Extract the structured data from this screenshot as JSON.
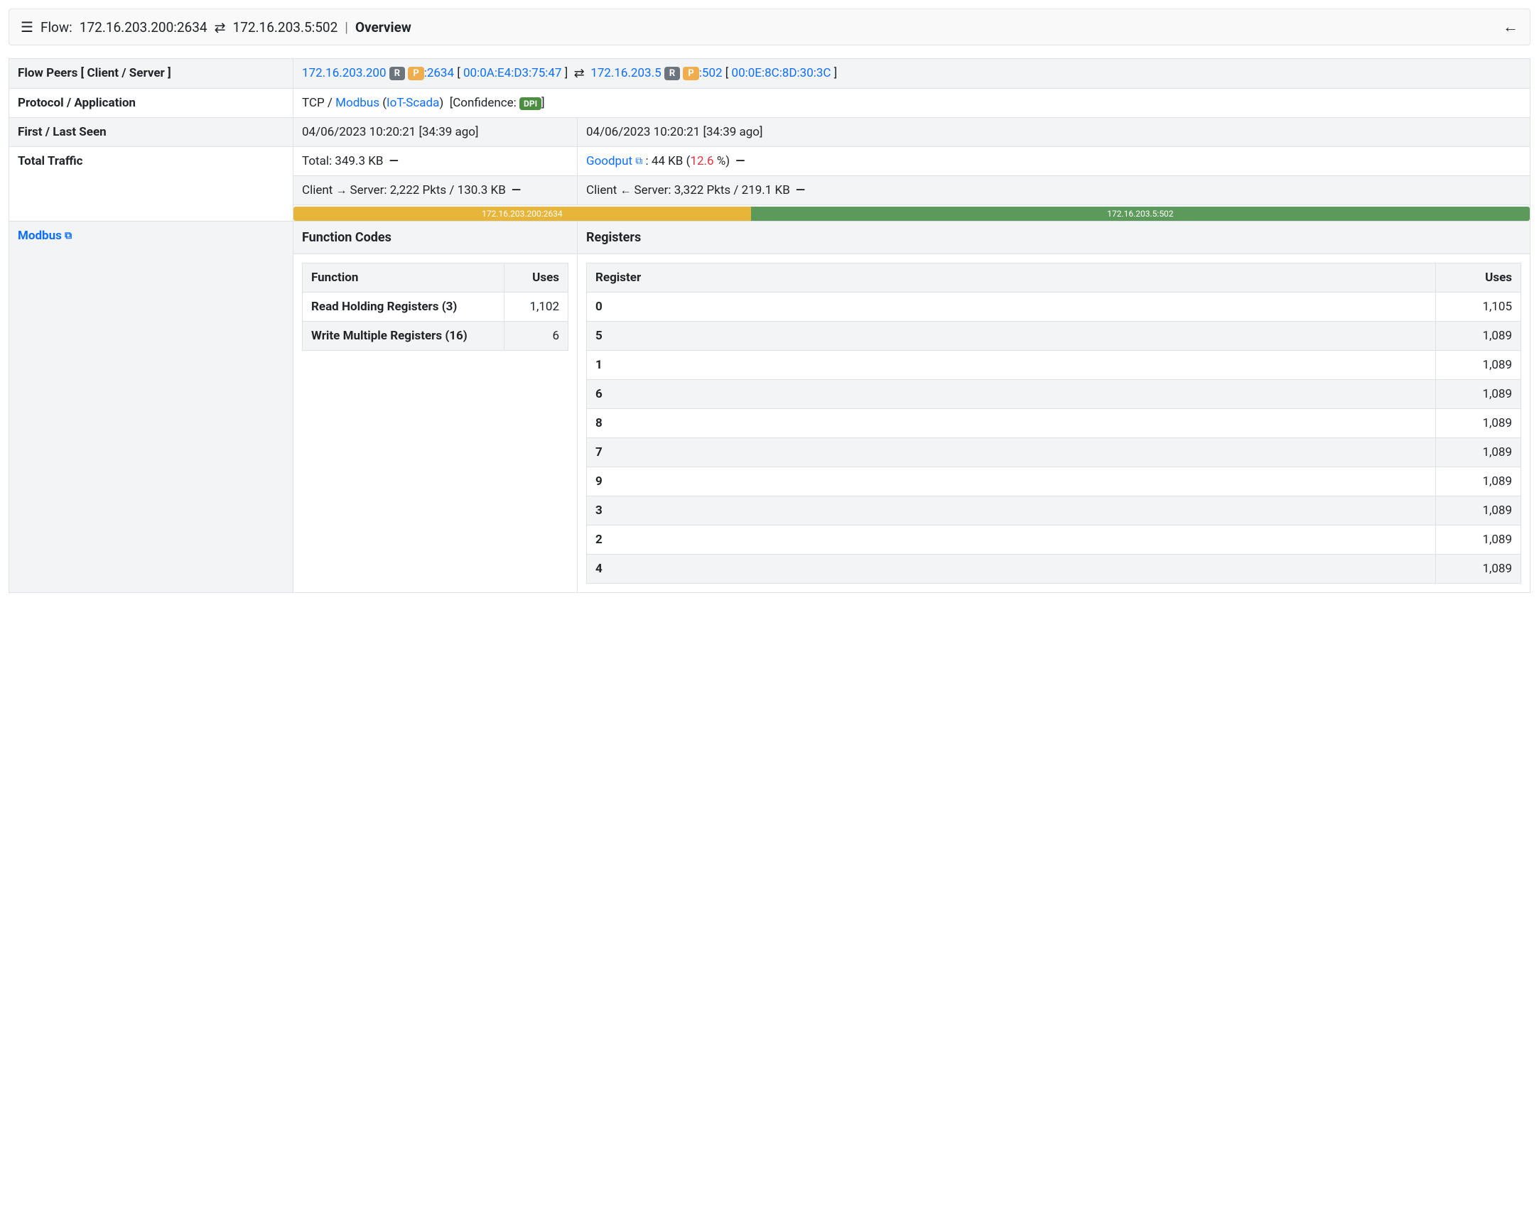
{
  "header": {
    "flow_label": "Flow:",
    "client_endpoint": "172.16.203.200:2634",
    "server_endpoint": "172.16.203.5:502",
    "tab": "Overview"
  },
  "flow_peers": {
    "label": "Flow Peers [ Client / Server ]",
    "client_ip": "172.16.203.200",
    "badge_r": "R",
    "badge_p": "P",
    "client_port": ":2634",
    "client_mac": "00:0A:E4:D3:75:47",
    "server_ip": "172.16.203.5",
    "server_port": ":502",
    "server_mac": "00:0E:8C:8D:30:3C"
  },
  "protocol": {
    "label": "Protocol / Application",
    "transport": "TCP /",
    "app": "Modbus",
    "category": "IoT-Scada",
    "confidence_label": "[Confidence:",
    "confidence_badge": "DPI",
    "confidence_close": "]"
  },
  "seen": {
    "label": "First / Last Seen",
    "first": "04/06/2023 10:20:21 [34:39 ago]",
    "last": "04/06/2023 10:20:21 [34:39 ago]"
  },
  "traffic": {
    "label": "Total Traffic",
    "total": "Total: 349.3 KB",
    "goodput_label": "Goodput",
    "goodput_value": ": 44 KB (",
    "goodput_pct": "12.6 ",
    "goodput_close": "%)",
    "client_to_server": "Server: 2,222 Pkts / 130.3 KB",
    "client_prefix": "Client",
    "server_to_client": "Server: 3,322 Pkts / 219.1 KB",
    "bar_client_label": "172.16.203.200:2634",
    "bar_server_label": "172.16.203.5:502"
  },
  "modbus": {
    "label": "Modbus",
    "function_codes_title": "Function Codes",
    "registers_title": "Registers",
    "function_header": "Function",
    "uses_header": "Uses",
    "register_header": "Register",
    "functions": [
      {
        "name": "Read Holding Registers (3)",
        "uses": "1,102"
      },
      {
        "name": "Write Multiple Registers (16)",
        "uses": "6"
      }
    ],
    "registers": [
      {
        "reg": "0",
        "uses": "1,105"
      },
      {
        "reg": "5",
        "uses": "1,089"
      },
      {
        "reg": "1",
        "uses": "1,089"
      },
      {
        "reg": "6",
        "uses": "1,089"
      },
      {
        "reg": "8",
        "uses": "1,089"
      },
      {
        "reg": "7",
        "uses": "1,089"
      },
      {
        "reg": "9",
        "uses": "1,089"
      },
      {
        "reg": "3",
        "uses": "1,089"
      },
      {
        "reg": "2",
        "uses": "1,089"
      },
      {
        "reg": "4",
        "uses": "1,089"
      }
    ]
  }
}
